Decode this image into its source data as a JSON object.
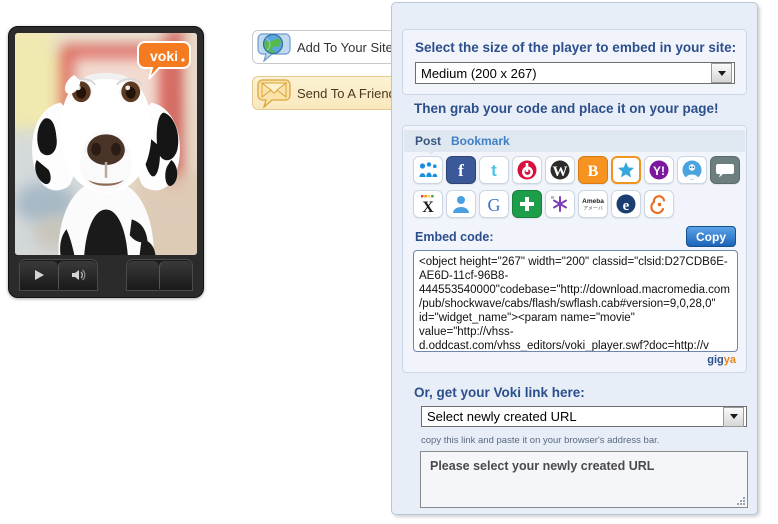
{
  "player": {
    "logo_text": "voki",
    "controls": {
      "play": "play-button",
      "volume": "volume-button",
      "blank1": "",
      "blank2": ""
    },
    "avatar": "dalmatian-dog-avatar"
  },
  "actions": [
    {
      "id": "add-to-your-site",
      "label": "Add To Your Site",
      "icon": "globe-speech-bubble-icon",
      "active": false
    },
    {
      "id": "send-to-a-friend",
      "label": "Send To A Friend",
      "icon": "envelope-speech-bubble-icon",
      "active": true
    }
  ],
  "panel": {
    "size_section": {
      "heading": "Select the size of the player to embed in your site:",
      "selected": "Medium (200 x 267)"
    },
    "code_heading": "Then grab your code and place it on your page!",
    "tabs": [
      {
        "label": "Post",
        "active": true
      },
      {
        "label": "Bookmark",
        "active": false
      }
    ],
    "share_icons_row1": [
      "myspace-icon",
      "facebook-icon",
      "twitter-icon",
      "bebo-icon",
      "wordpress-icon",
      "blogger-icon",
      "star-icon",
      "yahoo-icon",
      "friendster-icon",
      "comment-bubble-icon"
    ],
    "share_icons_row2": [
      "xanga-icon",
      "profile-person-icon",
      "google-icon",
      "plus-icon",
      "asterisk-icon",
      "ameba-icon",
      "live-e-icon",
      "spiral-icon"
    ],
    "ameba_icon_text": "Ameba",
    "ameba_icon_subtext": "アメーバ",
    "embed_label": "Embed code:",
    "copy_label": "Copy",
    "embed_code": "<object height=\"267\" width=\"200\" classid=\"clsid:D27CDB6E-AE6D-11cf-96B8-444553540000\"codebase=\"http://download.macromedia.com/pub/shockwave/cabs/flash/swflash.cab#version=9,0,28,0\" id=\"widget_name\"><param name=\"movie\" value=\"http://vhss-d.oddcast.com/vhss_editors/voki_player.swf?doc=http://v",
    "attribution_1": "gig",
    "attribution_2": "ya",
    "link_heading": "Or, get your Voki link here:",
    "link_selected": "Select newly created URL",
    "link_hint": "copy this link and paste it on your browser's address bar.",
    "url_value": "Please select your newly created URL"
  },
  "colors": {
    "panel_bg": "#e8eef7",
    "heading_blue": "#2c4f8c",
    "copy_button": "#1b63b8",
    "voki_orange": "#f47b20",
    "send_button_bg": "#fae8bd"
  }
}
